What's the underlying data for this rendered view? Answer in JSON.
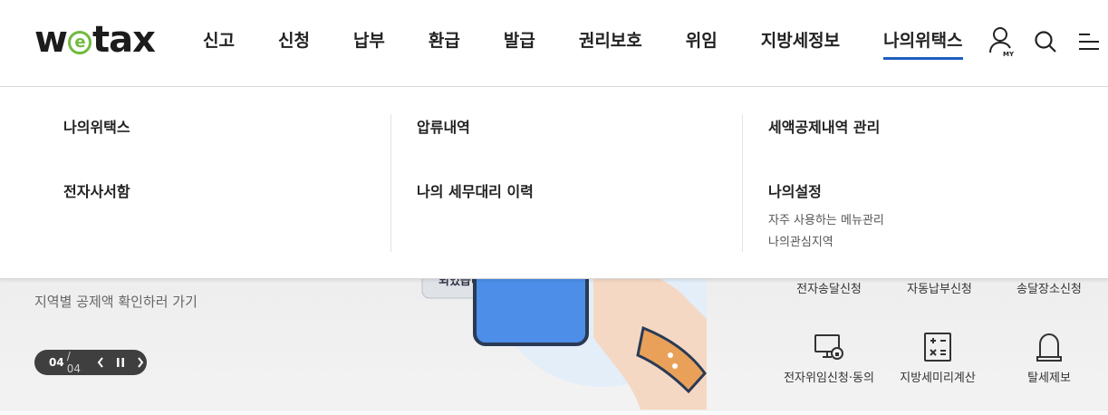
{
  "logo": {
    "text_a": "w",
    "text_e": "e",
    "text_b": "tax"
  },
  "gnb": [
    {
      "label": "신고"
    },
    {
      "label": "신청"
    },
    {
      "label": "납부"
    },
    {
      "label": "환급"
    },
    {
      "label": "발급"
    },
    {
      "label": "권리보호"
    },
    {
      "label": "위임"
    },
    {
      "label": "지방세정보"
    },
    {
      "label": "나의위택스",
      "active": true
    }
  ],
  "util": {
    "my_badge": "MY"
  },
  "mega": {
    "col1": {
      "items": [
        "나의위택스",
        "전자사서함"
      ]
    },
    "col2": {
      "items": [
        "압류내역",
        "나의 세무대리 이력"
      ]
    },
    "col3": {
      "items": [
        "세액공제내역 관리",
        "나의설정"
      ],
      "subs": [
        "자주 사용하는 메뉴관리",
        "나의관심지역"
      ]
    }
  },
  "banner": {
    "slogan": "지역별 공제액 확인하러 가기",
    "bubble_text": "되었습니다.",
    "pager": {
      "current": "04",
      "total": "/ 04"
    }
  },
  "quick_links": [
    {
      "label": "전자송달신청",
      "icon": "mail-device-icon"
    },
    {
      "label": "자동납부신청",
      "icon": "auto-pay-icon"
    },
    {
      "label": "송달장소신청",
      "icon": "delivery-place-icon"
    },
    {
      "label": "전자위임신청·동의",
      "icon": "monitor-lock-icon"
    },
    {
      "label": "지방세미리계산",
      "icon": "calculator-icon"
    },
    {
      "label": "탈세제보",
      "icon": "alarm-bell-icon"
    }
  ],
  "colors": {
    "accent": "#1d5fbf",
    "logo_green": "#6fbb3e"
  }
}
